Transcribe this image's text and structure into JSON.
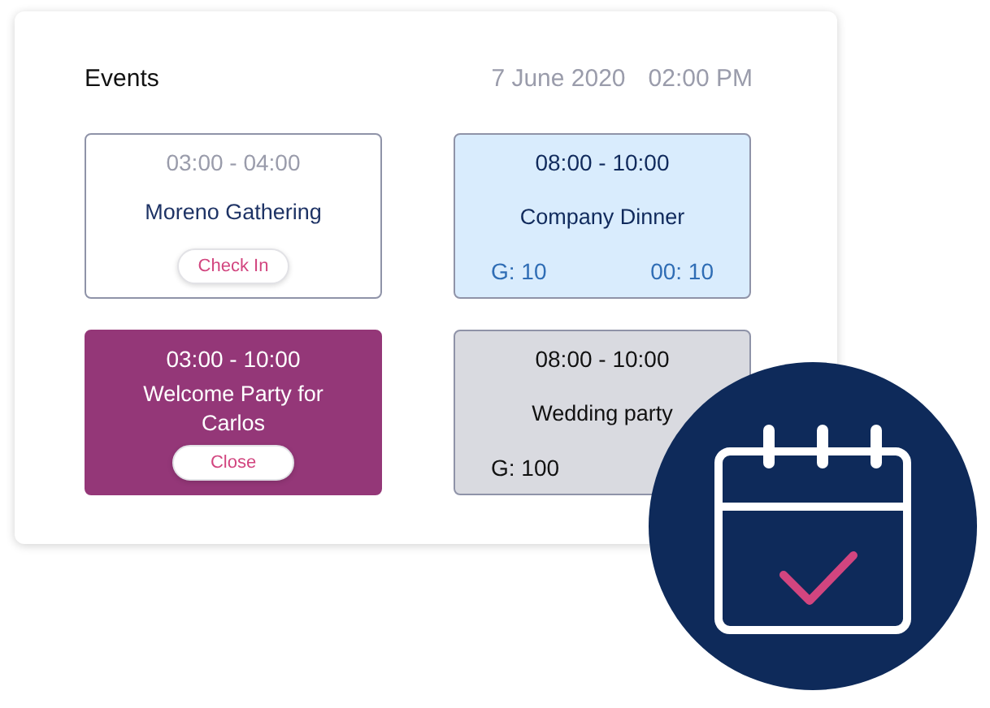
{
  "header": {
    "title": "Events",
    "date": "7 June 2020",
    "time": "02:00 PM"
  },
  "events": [
    {
      "kind": "outline",
      "time": "03:00 - 04:00",
      "name": "Moreno Gathering",
      "button": "Check In"
    },
    {
      "kind": "blue",
      "time": "08:00 - 10:00",
      "name": "Company Dinner",
      "guests": "G: 10",
      "duration": "00: 10"
    },
    {
      "kind": "purple",
      "time": "03:00 - 10:00",
      "name": "Welcome Party for Carlos",
      "button": "Close"
    },
    {
      "kind": "grey",
      "time": "08:00 - 10:00",
      "name": "Wedding party",
      "guests": "G: 100"
    }
  ]
}
